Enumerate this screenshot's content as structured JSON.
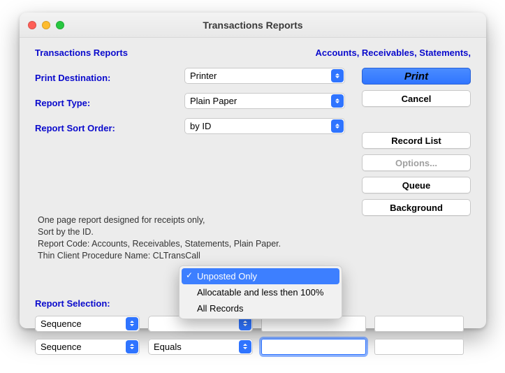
{
  "window": {
    "title": "Transactions Reports"
  },
  "header": {
    "left": "Transactions Reports",
    "right": "Accounts, Receivables, Statements,"
  },
  "labels": {
    "print_dest": "Print Destination:",
    "report_type": "Report Type:",
    "sort_order": "Report Sort Order:",
    "report_selection": "Report Selection:"
  },
  "selects": {
    "print_dest": {
      "value": "Printer"
    },
    "report_type": {
      "value": "Plain Paper"
    },
    "sort_order": {
      "value": "by ID"
    }
  },
  "description": {
    "line1": "One page report designed for receipts only,",
    "line2": "Sort by the ID.",
    "line3": "Report Code: Accounts, Receivables, Statements,  Plain Paper.",
    "line4": "Thin Client Procedure Name: CLTransCall"
  },
  "buttons": {
    "print": "Print",
    "cancel": "Cancel",
    "record_list": "Record List",
    "options": "Options...",
    "queue": "Queue",
    "background": "Background"
  },
  "filters": {
    "row1": {
      "field": "Sequence",
      "op": "",
      "val1": "",
      "val2": ""
    },
    "row2": {
      "field": "Sequence",
      "op": "Equals",
      "val1": "",
      "val2": ""
    }
  },
  "dropdown": {
    "opt1": "Unposted Only",
    "opt2": "Allocatable and less then 100%",
    "opt3": "All Records"
  }
}
